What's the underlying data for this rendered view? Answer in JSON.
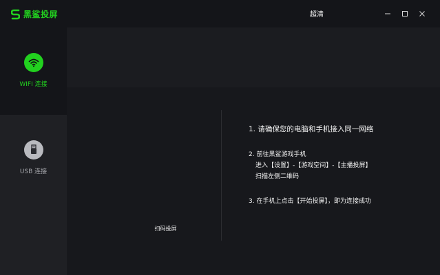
{
  "app": {
    "name": "黑鲨投屏",
    "brand_color": "#22d11f",
    "quality_label": "超清"
  },
  "window_controls": {
    "minimize_icon": "minimize-icon",
    "maximize_icon": "maximize-icon",
    "close_icon": "close-icon"
  },
  "sidebar": {
    "items": [
      {
        "label": "WIFI 连接",
        "icon": "wifi-icon",
        "active": true
      },
      {
        "label": "USB 连接",
        "icon": "usb-icon",
        "active": false
      }
    ]
  },
  "main": {
    "qr_caption": "扫码投屏",
    "steps": {
      "step1": "1. 请确保您的电脑和手机接入同一网络",
      "step2_title": "2. 前往黑鲨游戏手机",
      "step2_line2": "进入【设置】-【游戏空间】-【主播投屏】",
      "step2_line3": "扫描左侧二维码",
      "step3": "3. 在手机上点击【开始投屏】，即为连接成功"
    }
  }
}
